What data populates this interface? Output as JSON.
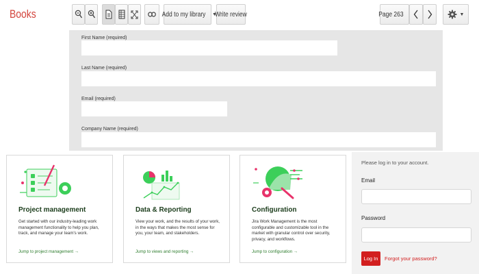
{
  "app": {
    "title": "Books"
  },
  "toolbar": {
    "icons": [
      "zoom-out-icon",
      "zoom-in-icon",
      "single-page-icon",
      "list-view-icon",
      "fullscreen-icon",
      "link-icon",
      "settings-gear-icon"
    ],
    "add_library_label": "Add to my library",
    "write_review_label": "Write review",
    "page_label": "Page 263"
  },
  "form": {
    "fields": [
      {
        "label": "First Name (required)",
        "value": ""
      },
      {
        "label": "Last Name (required)",
        "value": ""
      },
      {
        "label": "Email (required)",
        "value": ""
      },
      {
        "label": "Company Name (required)",
        "value": ""
      }
    ]
  },
  "cards": [
    {
      "title": "Project management",
      "body": "Get started with our industry-leading work management functionality to help you plan, track, and manage your team's work.",
      "link": "Jump to project management →"
    },
    {
      "title": "Data & Reporting",
      "body": "View your work, and the results of your work, in the ways that makes the most sense for you, your team, and stakeholders.",
      "link": "Jump to views and reporting →"
    },
    {
      "title": "Configuration",
      "body": "Jira Work Management is the most configurable and customizable tool in the market with granular control over security, privacy, and workflows.",
      "link": "Jump to configuration →"
    }
  ],
  "login": {
    "intro": "Please log in to your account.",
    "email_label": "Email",
    "password_label": "Password",
    "button_label": "Log In",
    "forgot_label": "Forgot your password?"
  },
  "colors": {
    "brand": "#d3443c",
    "accent_green": "#3ccf5a",
    "login_red": "#d21f1f"
  }
}
